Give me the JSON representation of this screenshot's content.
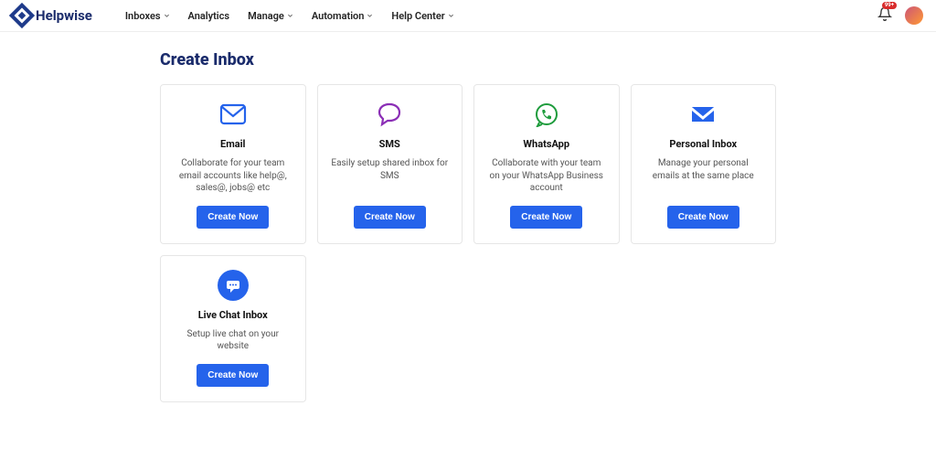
{
  "app_name": "Helpwise",
  "nav": [
    {
      "label": "Inboxes",
      "dropdown": true
    },
    {
      "label": "Analytics",
      "dropdown": false
    },
    {
      "label": "Manage",
      "dropdown": true
    },
    {
      "label": "Automation",
      "dropdown": true
    },
    {
      "label": "Help Center",
      "dropdown": true
    }
  ],
  "notifications_badge": "99+",
  "page_title": "Create Inbox",
  "create_label": "Create Now",
  "cards": [
    {
      "id": "email",
      "title": "Email",
      "description": "Collaborate for your team email accounts like help@, sales@, jobs@ etc",
      "icon": "envelope-icon",
      "color": "#2563eb"
    },
    {
      "id": "sms",
      "title": "SMS",
      "description": "Easily setup shared inbox for SMS",
      "icon": "chat-bubble-icon",
      "color": "#8b2fb6"
    },
    {
      "id": "whatsapp",
      "title": "WhatsApp",
      "description": "Collaborate with your team on your WhatsApp Business account",
      "icon": "whatsapp-icon",
      "color": "#1f9c3d"
    },
    {
      "id": "personal",
      "title": "Personal Inbox",
      "description": "Manage your personal emails at the same place",
      "icon": "inbox-tray-icon",
      "color": "#2563eb"
    },
    {
      "id": "livechat",
      "title": "Live Chat Inbox",
      "description": "Setup live chat on your website",
      "icon": "chat-circle-icon",
      "color": "#2563eb"
    }
  ]
}
